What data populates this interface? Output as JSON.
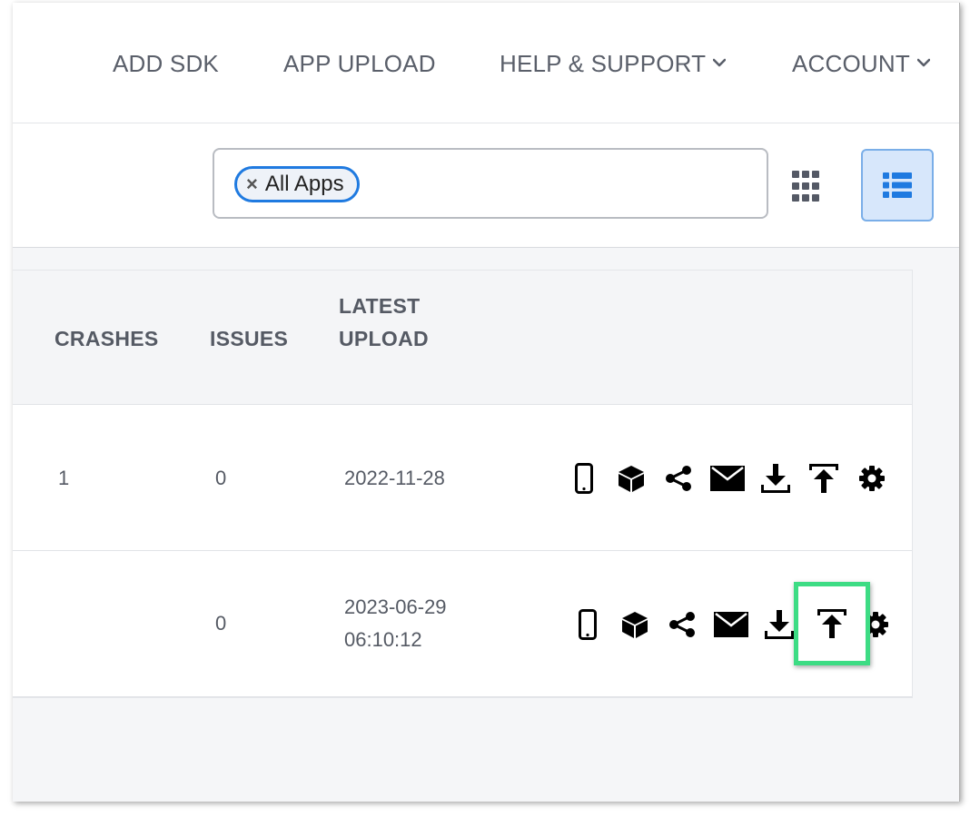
{
  "nav": {
    "add_sdk": "ADD SDK",
    "app_upload": "APP UPLOAD",
    "help_support": "HELP & SUPPORT",
    "account": "ACCOUNT"
  },
  "filter": {
    "chip_label": "All Apps",
    "chip_remove": "×"
  },
  "table": {
    "headers": {
      "crashes": "CRASHES",
      "issues": "ISSUES",
      "latest_upload_line1": "LATEST",
      "latest_upload_line2": "UPLOAD"
    },
    "rows": [
      {
        "crashes": "1",
        "issues": "0",
        "latest_upload_line1": "2022-11-28",
        "latest_upload_line2": ""
      },
      {
        "crashes": "",
        "issues": "0",
        "latest_upload_line1": "2023-06-29",
        "latest_upload_line2": "06:10:12"
      }
    ],
    "action_icons": [
      "phone-icon",
      "package-icon",
      "share-icon",
      "mail-icon",
      "download-icon",
      "upload-icon",
      "gear-icon"
    ]
  },
  "colors": {
    "accent": "#1f7ae0",
    "highlight": "#3ddc84",
    "text_muted": "#555a64"
  }
}
